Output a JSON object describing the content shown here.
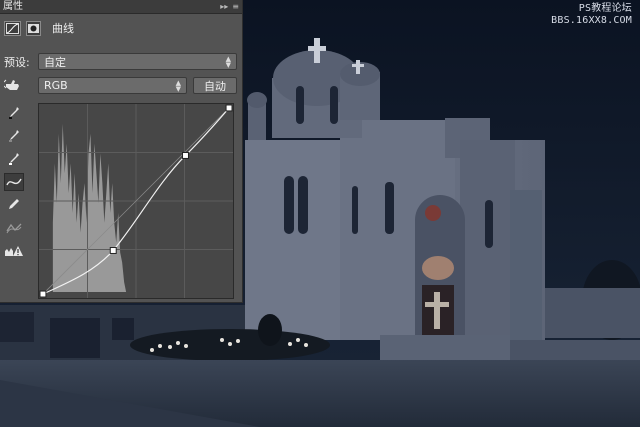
{
  "panel": {
    "title": "属性",
    "collapse_glyph": "▸▸",
    "menu_glyph": "≡",
    "adjustment_name": "曲线",
    "preset_label": "预设:",
    "preset_value": "自定",
    "channel_value": "RGB",
    "auto_button": "自动"
  },
  "tools": [
    {
      "icon": "on-image-adjust-icon"
    },
    {
      "icon": "black-point-eyedropper-icon"
    },
    {
      "icon": "gray-point-eyedropper-icon"
    },
    {
      "icon": "white-point-eyedropper-icon"
    },
    {
      "icon": "curve-edit-icon"
    },
    {
      "icon": "pencil-draw-icon"
    },
    {
      "icon": "smooth-curve-icon"
    },
    {
      "icon": "clipping-warning-icon"
    }
  ],
  "curve": {
    "points_input_output": [
      [
        0,
        0
      ],
      [
        98,
        34
      ],
      [
        196,
        178
      ],
      [
        255,
        255
      ]
    ]
  },
  "watermark": {
    "line1": "PS教程论坛",
    "line2": "BBS.16XX8.COM"
  },
  "colors": {
    "panel_bg": "#535353",
    "graph_bg": "#484848",
    "sky": "#0e1626",
    "church_stone": "#7d8597"
  }
}
